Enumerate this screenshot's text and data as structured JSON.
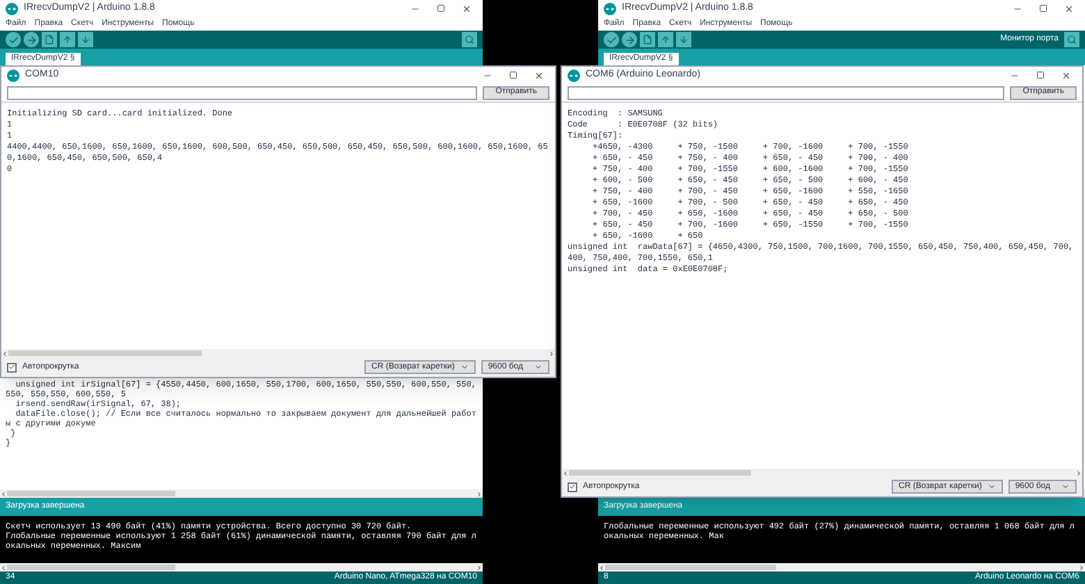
{
  "ide_windows": [
    {
      "title": "IRrecvDumpV2 | Arduino 1.8.8",
      "menu": [
        "Файл",
        "Правка",
        "Скетч",
        "Инструменты",
        "Помощь"
      ],
      "tab": "IRrecvDumpV2 §",
      "code_lines": [
        "  unsigned int irSignal[67] = {4550,4450, 600,1650, 550,1700, 600,1650, 550,550, 600,550, 550,550, 550,550, 600,550, 5",
        "  irsend.sendRaw(irSignal, 67, 38);",
        "  dataFile.close(); // Если все считалось нормально то закрываем документ для дальнейшей работы с другими докуме",
        " }",
        "}"
      ],
      "status": "Загрузка завершена",
      "console_lines": [
        "Скетч использует 13 490 байт (41%) памяти устройства. Всего доступно 30 720 байт.",
        "Глобальные переменные используют 1 258 байт (61%) динамической памяти, оставляя 790 байт для локальных переменных. Максим"
      ],
      "line_number": "34",
      "board": "Arduino Nano, ATmega328 на COM10"
    },
    {
      "title": "IRrecvDumpV2 | Arduino 1.8.8",
      "menu": [
        "Файл",
        "Правка",
        "Скетч",
        "Инструменты",
        "Помощь"
      ],
      "toolbar_label": "Монитор порта",
      "tab": "IRrecvDumpV2 §",
      "status": "Загрузка завершена",
      "console_lines": [
        "Глобальные переменные используют 492 байт (27%) динамической памяти, оставляя 1 068 байт для локальных переменных. Мак"
      ],
      "line_number": "8",
      "board": "Arduino Leonardo на COM6"
    }
  ],
  "serial_monitors": [
    {
      "title": "COM10",
      "send_button": "Отправить",
      "output_lines": [
        "Initializing SD card...card initialized. Done",
        "1",
        "1",
        "4400,4400, 650,1600, 650,1600, 650,1600, 600,500, 650,450, 650,500, 650,450, 650,500, 600,1600, 650,1600, 650,1600, 650,450, 650,500, 650,4",
        "0"
      ],
      "autoscroll": {
        "label": "Автопрокрутка",
        "checked": true
      },
      "line_ending": "CR (Возврат каретки)",
      "baud": "9600 бод"
    },
    {
      "title": "COM6 (Arduino Leonardo)",
      "send_button": "Отправить",
      "output_lines": [
        "Encoding  : SAMSUNG",
        "Code      : E0E0708F (32 bits)",
        "Timing[67]:",
        "     +4650, -4300     + 750, -1500     + 700, -1600     + 700, -1550",
        "     + 650, - 450     + 750, - 400     + 650, - 450     + 700, - 400",
        "     + 750, - 400     + 700, -1550     + 600, -1600     + 700, -1550",
        "     + 600, - 500     + 650, - 450     + 650, - 500     + 600, - 450",
        "     + 750, - 400     + 700, - 450     + 650, -1600     + 550, -1650",
        "     + 650, -1600     + 700, - 500     + 650, - 450     + 650, - 450",
        "     + 700, - 450     + 650, -1600     + 650, - 450     + 650, - 500",
        "     + 650, - 450     + 700, -1600     + 650, -1550     + 700, -1550",
        "     + 650, -1600     + 650",
        "unsigned int  rawData[67] = {4650,4300, 750,1500, 700,1600, 700,1550, 650,450, 750,400, 650,450, 700,400, 750,400, 700,1550, 650,1",
        "unsigned int  data = 0xE0E0708F;"
      ],
      "autoscroll": {
        "label": "Автопрокрутка",
        "checked": true
      },
      "line_ending": "CR (Возврат каретки)",
      "baud": "9600 бод"
    }
  ]
}
